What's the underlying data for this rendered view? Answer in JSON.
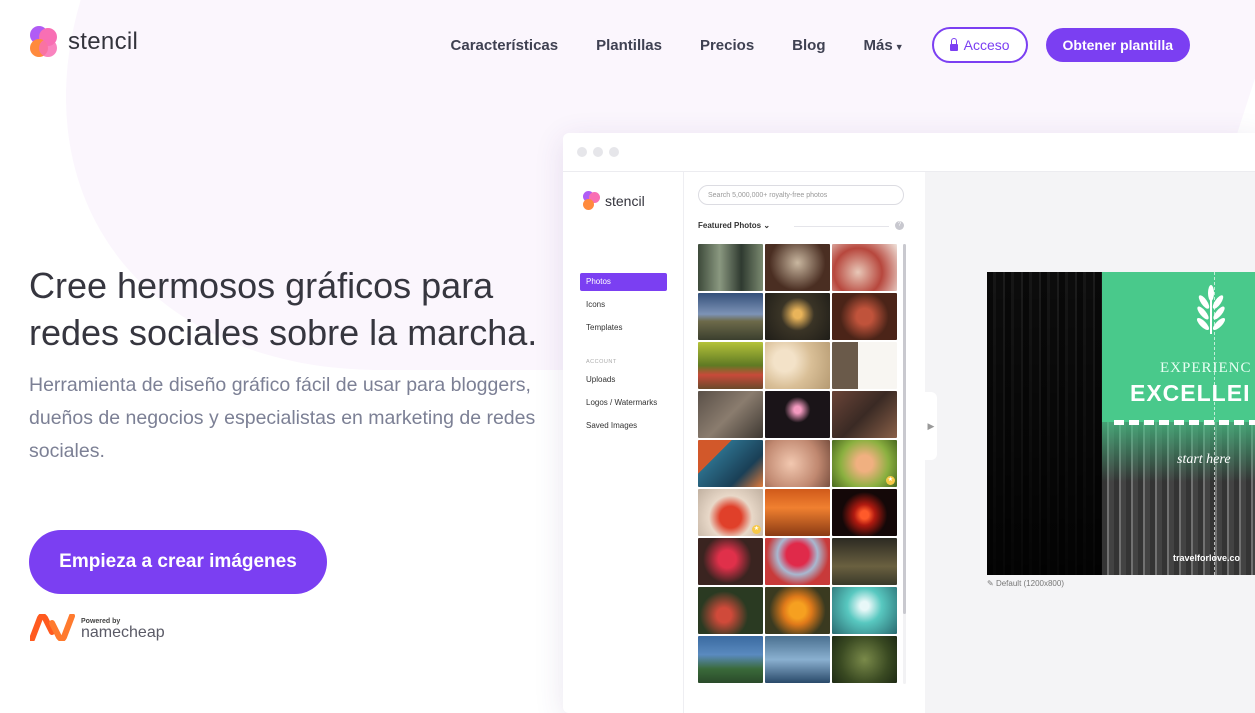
{
  "brand": {
    "name": "stencil",
    "colors": {
      "accent": "#7b3ff2",
      "pink": "#f86fb4",
      "orange": "#ff8a3d"
    }
  },
  "nav": {
    "links": [
      "Características",
      "Plantillas",
      "Precios",
      "Blog"
    ],
    "more": "Más",
    "login": "Acceso",
    "get": "Obtener plantilla"
  },
  "hero": {
    "title": "Cree hermosos gráficos para redes sociales sobre la marcha.",
    "subtitle": "Herramienta de diseño gráfico fácil de usar para bloggers, dueños de negocios y especialistas en marketing de redes sociales.",
    "cta": "Empieza a crear imágenes"
  },
  "powered": {
    "small": "Powered by",
    "name": "namecheap"
  },
  "app": {
    "logo": "stencil",
    "sidebar": {
      "items": [
        "Photos",
        "Icons",
        "Templates"
      ],
      "section": "ACCOUNT",
      "account_items": [
        "Uploads",
        "Logos / Watermarks",
        "Saved Images"
      ]
    },
    "search_placeholder": "Search 5,000,000+ royalty-free photos",
    "featured_label": "Featured Photos",
    "help": "?",
    "canvas": {
      "line1": "EXPERIENC",
      "line2": "EXCELLEI",
      "line3": "start here",
      "url": "travelforlove.co",
      "size_label": "Default (1200x800)"
    }
  }
}
